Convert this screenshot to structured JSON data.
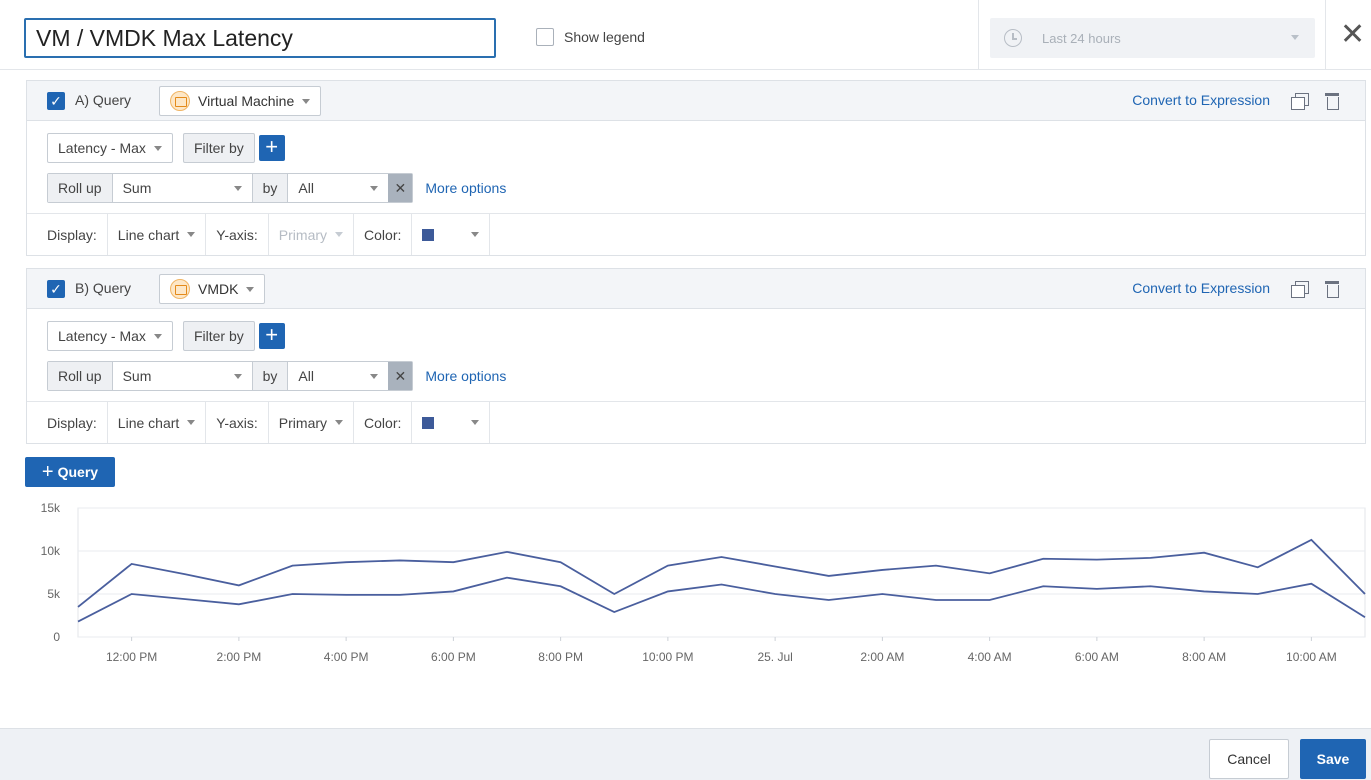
{
  "header": {
    "title": "VM / VMDK Max Latency",
    "show_legend_label": "Show legend",
    "time_range": "Last 24 hours",
    "close_glyph": "✕"
  },
  "queries": [
    {
      "label": "A) Query",
      "object_type": "Virtual Machine",
      "metric": "Latency - Max",
      "filter_label": "Filter by",
      "rollup_label": "Roll up",
      "rollup_value": "Sum",
      "by_label": "by",
      "by_value": "All",
      "more_options": "More options",
      "convert_label": "Convert to Expression",
      "display_label": "Display:",
      "display_value": "Line chart",
      "yaxis_label": "Y-axis:",
      "yaxis_value": "Primary",
      "color_label": "Color:",
      "color": "#3d5a99"
    },
    {
      "label": "B) Query",
      "object_type": "VMDK",
      "metric": "Latency - Max",
      "filter_label": "Filter by",
      "rollup_label": "Roll up",
      "rollup_value": "Sum",
      "by_label": "by",
      "by_value": "All",
      "more_options": "More options",
      "convert_label": "Convert to Expression",
      "display_label": "Display:",
      "display_value": "Line chart",
      "yaxis_label": "Y-axis:",
      "yaxis_value": "Primary",
      "color_label": "Color:",
      "color": "#3d5a99"
    }
  ],
  "add_query_label": "Query",
  "chart_data": {
    "type": "line",
    "ylim": [
      0,
      15000
    ],
    "yticks": [
      "0",
      "5k",
      "10k",
      "15k"
    ],
    "ytick_values": [
      0,
      5000,
      10000,
      15000
    ],
    "xticks": [
      "12:00 PM",
      "2:00 PM",
      "4:00 PM",
      "6:00 PM",
      "8:00 PM",
      "10:00 PM",
      "25. Jul",
      "2:00 AM",
      "4:00 AM",
      "6:00 AM",
      "8:00 AM",
      "10:00 AM"
    ],
    "xtick_positions": [
      1,
      3,
      5,
      7,
      9,
      11,
      13,
      15,
      17,
      19,
      21,
      23
    ],
    "series": [
      {
        "color": "#4a5f9e",
        "x": [
          0,
          1,
          2,
          3,
          4,
          5,
          6,
          7,
          8,
          9,
          10,
          11,
          12,
          13,
          14,
          15,
          16,
          17,
          18,
          19,
          20,
          21,
          22,
          23,
          24
        ],
        "values": [
          3500,
          8500,
          7300,
          6000,
          8300,
          8700,
          8900,
          8700,
          9900,
          8700,
          5000,
          8300,
          9300,
          8200,
          7100,
          7800,
          8300,
          7400,
          9100,
          9000,
          9200,
          9800,
          8100,
          11300,
          5000
        ]
      },
      {
        "color": "#4a5f9e",
        "x": [
          0,
          1,
          2,
          3,
          4,
          5,
          6,
          7,
          8,
          9,
          10,
          11,
          12,
          13,
          14,
          15,
          16,
          17,
          18,
          19,
          20,
          21,
          22,
          23,
          24
        ],
        "values": [
          1800,
          5000,
          4400,
          3800,
          5000,
          4900,
          4900,
          5300,
          6900,
          5900,
          2900,
          5300,
          6100,
          5000,
          4300,
          5000,
          4300,
          4300,
          5900,
          5600,
          5900,
          5300,
          5000,
          6200,
          2300
        ]
      }
    ]
  },
  "footer": {
    "cancel_label": "Cancel",
    "save_label": "Save"
  }
}
